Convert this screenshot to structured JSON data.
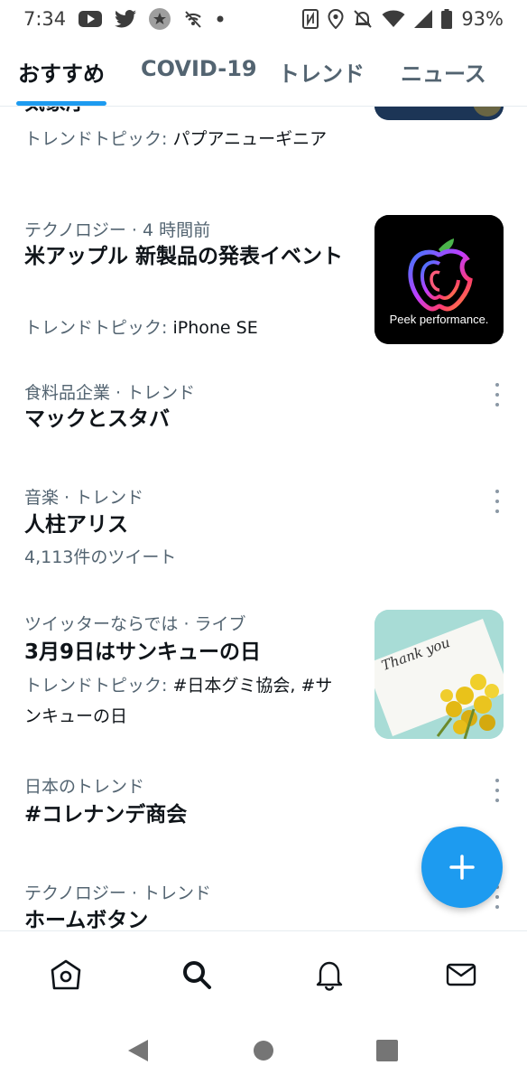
{
  "status_bar": {
    "time": "7:34",
    "battery": "93%",
    "icons": [
      "youtube-icon",
      "twitter-icon",
      "star-icon",
      "no-wifi-call-icon",
      "dot-icon",
      "nfc-icon",
      "location-icon",
      "mute-icon",
      "wifi-icon",
      "signal-icon",
      "battery-icon"
    ]
  },
  "tabs": [
    {
      "label": "おすすめ",
      "active": true
    },
    {
      "label": "COVID-19",
      "active": false
    },
    {
      "label": "トレンド",
      "active": false
    },
    {
      "label": "ニュース",
      "active": false
    }
  ],
  "feed": {
    "items": [
      {
        "headline": "気象庁",
        "sub_prefix": "トレンドトピック: ",
        "sub_value": "パプアニューギニア"
      },
      {
        "meta": "テクノロジー · 4 時間前",
        "headline": "米アップル 新製品の発表イベント",
        "sub_prefix": "トレンドトピック: ",
        "sub_value": "iPhone SE",
        "thumb_text": "Peek performance."
      },
      {
        "meta": "食料品企業 · トレンド",
        "headline": "マックとスタバ"
      },
      {
        "meta": "音楽 · トレンド",
        "headline": "人柱アリス",
        "sub": "4,113件のツイート"
      },
      {
        "meta": "ツイッターならでは · ライブ",
        "headline": "3月9日はサンキューの日",
        "sub_prefix": "トレンドトピック: ",
        "sub_value": "#日本グミ協会, #サンキューの日",
        "thumb_text": "Thank you"
      },
      {
        "meta": "日本のトレンド",
        "headline": "#コレナンデ商会"
      },
      {
        "meta": "テクノロジー · トレンド",
        "headline": "ホームボタン"
      }
    ]
  },
  "fab": {
    "icon": "plus-icon"
  },
  "bottom_nav": {
    "items": [
      "home-icon",
      "search-icon",
      "notifications-icon",
      "messages-icon"
    ]
  },
  "system_nav": {
    "items": [
      "back-icon",
      "home-circle-icon",
      "recents-icon"
    ]
  },
  "colors": {
    "accent": "#1d9bf0",
    "text": "#0f1419",
    "secondary": "#536471"
  }
}
